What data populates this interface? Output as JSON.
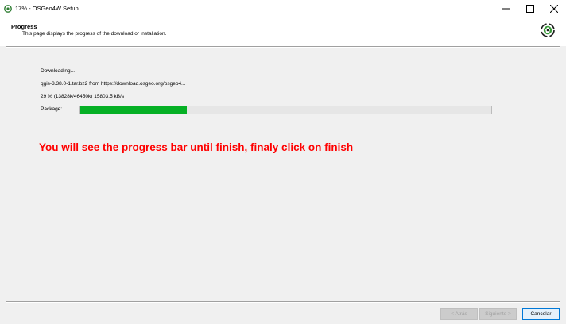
{
  "window": {
    "title": "17% - OSGeo4W Setup",
    "controls": {
      "minimize": "–",
      "maximize": "☐",
      "close": "✕"
    }
  },
  "header": {
    "title": "Progress",
    "subtitle": "This page displays the progress of the download or installation.",
    "logo_icon": "osgeo-logo-icon"
  },
  "progress": {
    "status": "Downloading...",
    "file": "qgis-3.38.0-1.tar.bz2 from https://download.osgeo.org/osgeo4...",
    "detail": "29 %  (13828k/46450k)  15803.5 kB/s",
    "package_label": "Package:",
    "fraction": 0.26,
    "bar_color": "#06b025"
  },
  "annotation": {
    "text": "You will see the progress bar until finish, finaly click on finish",
    "color": "#ff0000"
  },
  "buttons": {
    "back": "< Atrás",
    "next": "Siguiente >",
    "cancel": "Cancelar"
  }
}
